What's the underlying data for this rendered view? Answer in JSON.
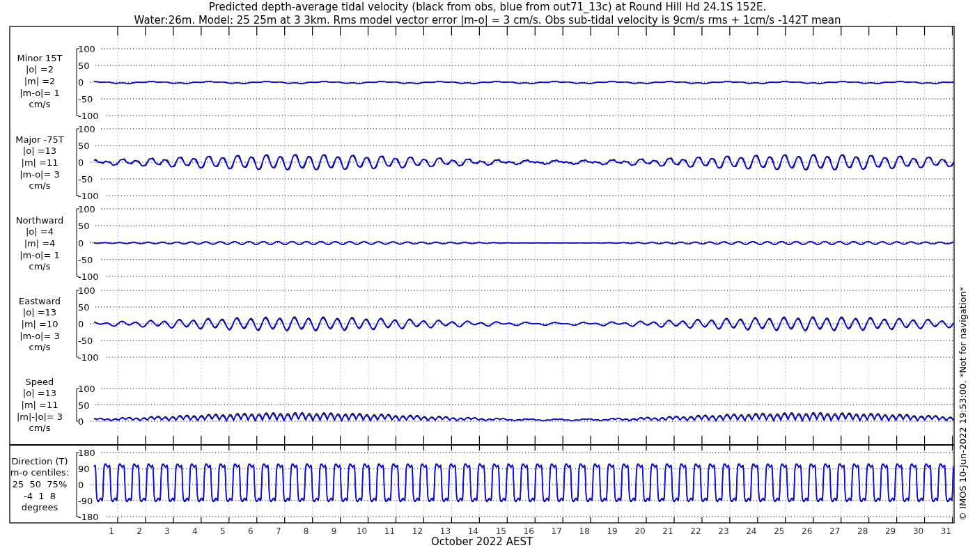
{
  "title_lines": [
    "Predicted depth-average tidal velocity (black from obs, blue from out71_13c) at Round Hill Hd 24.1S 152E.",
    "Water:26m. Model: 25 25m at 3 3km. Rms model vector error |m-o| = 3 cm/s. Obs sub-tidal velocity is 9cm/s rms + 1cm/s -142T mean"
  ],
  "panels": [
    {
      "kind": "minor",
      "label_lines": [
        "Minor 15T",
        "|o| =2",
        "|m| =2",
        "|m-o|= 1",
        "cm/s"
      ],
      "yticks": [
        "100",
        "50",
        "0",
        "-50",
        "-100"
      ]
    },
    {
      "kind": "major",
      "label_lines": [
        "Major -75T",
        "|o| =13",
        "|m| =11",
        "|m-o|= 3",
        "cm/s"
      ],
      "yticks": [
        "100",
        "50",
        "0",
        "-50",
        "-100"
      ]
    },
    {
      "kind": "north",
      "label_lines": [
        "Northward",
        "|o| =4",
        "|m| =4",
        "|m-o|= 1",
        "cm/s"
      ],
      "yticks": [
        "100",
        "50",
        "0",
        "-50",
        "-100"
      ]
    },
    {
      "kind": "east",
      "label_lines": [
        "Eastward",
        "|o| =13",
        "|m| =10",
        "|m-o|= 3",
        "cm/s"
      ],
      "yticks": [
        "100",
        "50",
        "0",
        "-50",
        "-100"
      ]
    },
    {
      "kind": "speed",
      "label_lines": [
        "Speed",
        "|o| =13",
        "|m| =11",
        "|m|-|o|= 3",
        "cm/s"
      ],
      "yticks": [
        "100",
        "50",
        "0"
      ]
    },
    {
      "kind": "direction",
      "label_lines": [
        "Direction (T)",
        "m-o centiles:",
        "25  50  75%",
        "-4  1  8",
        "degrees"
      ],
      "yticks": [
        "180",
        "90",
        "0",
        "-90",
        "-180"
      ]
    }
  ],
  "days": [
    "1",
    "2",
    "3",
    "4",
    "5",
    "6",
    "7",
    "8",
    "9",
    "10",
    "11",
    "12",
    "13",
    "14",
    "15",
    "16",
    "17",
    "18",
    "19",
    "20",
    "21",
    "22",
    "23",
    "24",
    "25",
    "26",
    "27",
    "28",
    "29",
    "30",
    "31"
  ],
  "xlabel": "October 2022 AEST",
  "side_note": "© IMOS 10-Jun-2022 19:53:00. *Not for navigation*"
}
